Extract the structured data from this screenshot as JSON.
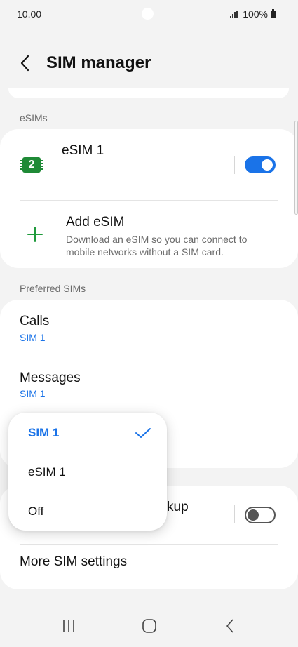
{
  "status_bar": {
    "time": "10.00",
    "battery": "100%",
    "icons": [
      "signal-icon",
      "battery-icon"
    ]
  },
  "header": {
    "title": "SIM manager",
    "back_icon": "chevron-left-icon"
  },
  "esims": {
    "section_label": "eSIMs",
    "esim": {
      "name": "eSIM 1",
      "icon": "sim-card-icon",
      "icon_label": "2",
      "enabled": true
    },
    "add": {
      "title": "Add eSIM",
      "description_line1": "Download an eSIM so you can connect to",
      "description_line2": "mobile networks without a SIM card.",
      "icon": "plus-icon"
    }
  },
  "preferred": {
    "section_label": "Preferred SIMs",
    "calls": {
      "title": "Calls",
      "value": "SIM 1"
    },
    "messages": {
      "title": "Messages",
      "value": "SIM 1"
    }
  },
  "other": {
    "backup_title_partial": "kup",
    "backup_enabled": false,
    "more_settings": "More SIM settings"
  },
  "popup": {
    "options": [
      {
        "label": "SIM 1",
        "selected": true
      },
      {
        "label": "eSIM 1",
        "selected": false
      },
      {
        "label": "Off",
        "selected": false
      }
    ]
  },
  "nav_bar": {
    "icons": [
      "recent-apps-icon",
      "home-icon",
      "back-icon"
    ]
  },
  "colors": {
    "accent": "#1a73e8",
    "sim_green": "#1f8a36",
    "plus_green": "#1f9a3c",
    "background": "#f3f3f3"
  }
}
